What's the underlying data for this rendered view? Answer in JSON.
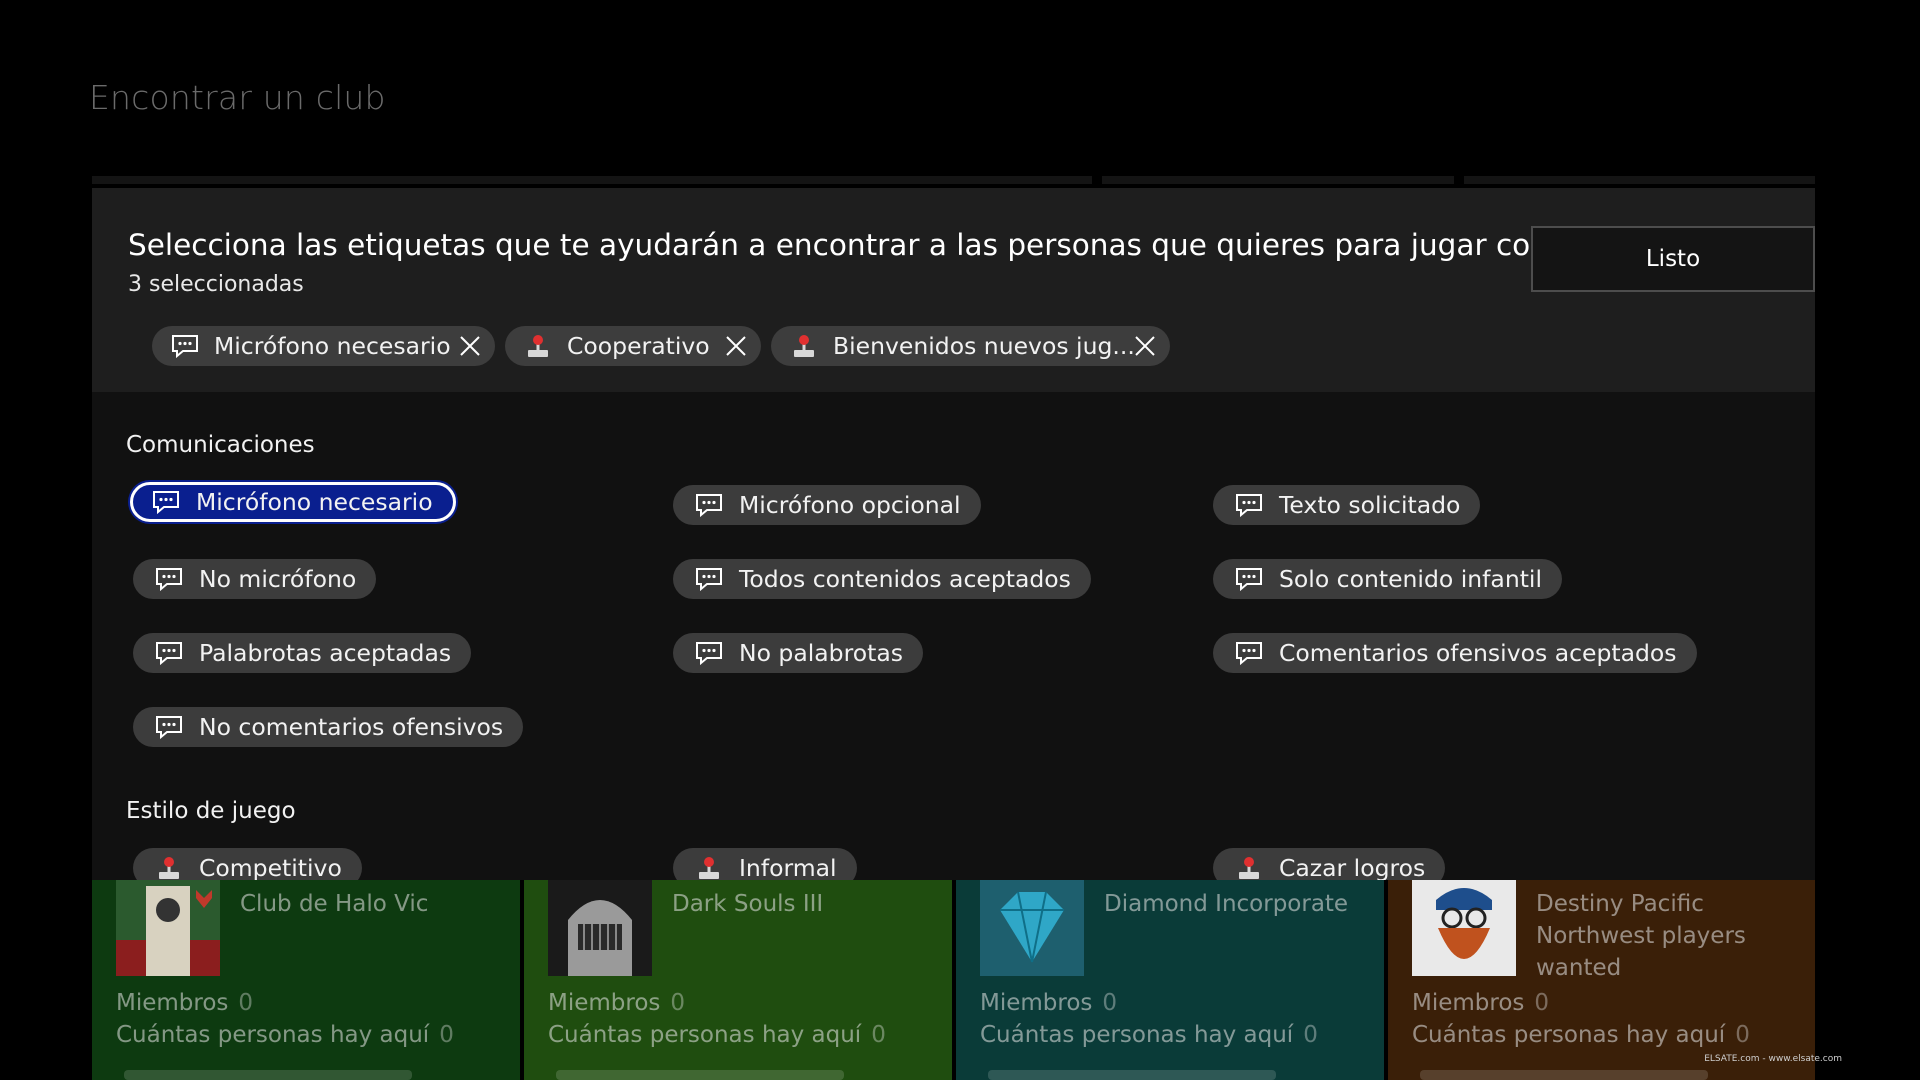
{
  "page": {
    "title": "Encontrar un club"
  },
  "dialog": {
    "headline": "Selecciona las etiquetas que te ayudarán a encontrar a las personas que quieres para jugar como tú",
    "selected_count": "3 seleccionadas",
    "done_label": "Listo",
    "selected_chips": [
      {
        "label": "Micrófono necesario",
        "icon": "chat-bubble-icon"
      },
      {
        "label": "Cooperativo",
        "icon": "joystick-icon"
      },
      {
        "label": "Bienvenidos nuevos jug...",
        "icon": "joystick-icon"
      }
    ]
  },
  "sections": {
    "communications": {
      "title": "Comunicaciones",
      "tags": [
        "Micrófono necesario",
        "Micrófono opcional",
        "Texto solicitado",
        "No micrófono",
        "Todos contenidos aceptados",
        "Solo contenido infantil",
        "Palabrotas aceptadas",
        "No palabrotas",
        "Comentarios ofensivos aceptados",
        "No comentarios ofensivos"
      ],
      "focused_tag": "Micrófono necesario"
    },
    "play_style": {
      "title": "Estilo de juego",
      "tags": [
        "Competitivo",
        "Informal",
        "Cazar logros"
      ]
    }
  },
  "clubs": [
    {
      "name": "Club de Halo Vic",
      "members_label": "Miembros",
      "members": "0",
      "here_label": "Cuántas personas hay aquí",
      "here": "0",
      "color": "#0d3a10"
    },
    {
      "name": "Dark Souls III",
      "members_label": "Miembros",
      "members": "0",
      "here_label": "Cuántas personas hay aquí",
      "here": "0",
      "color": "#1f4d0f"
    },
    {
      "name": "Diamond Incorporate",
      "members_label": "Miembros",
      "members": "0",
      "here_label": "Cuántas personas hay aquí",
      "here": "0",
      "color": "#0a3b38"
    },
    {
      "name": "Destiny Pacific Northwest players wanted",
      "members_label": "Miembros",
      "members": "0",
      "here_label": "Cuántas personas hay aquí",
      "here": "0",
      "color": "#3a1f08"
    }
  ],
  "watermark": "ELSATE.com - www.elsate.com",
  "colors": {
    "focus": "#0a1f8f",
    "chip": "#3c3c3c",
    "panel": "#111111",
    "panel_head": "#1e1e1e"
  }
}
